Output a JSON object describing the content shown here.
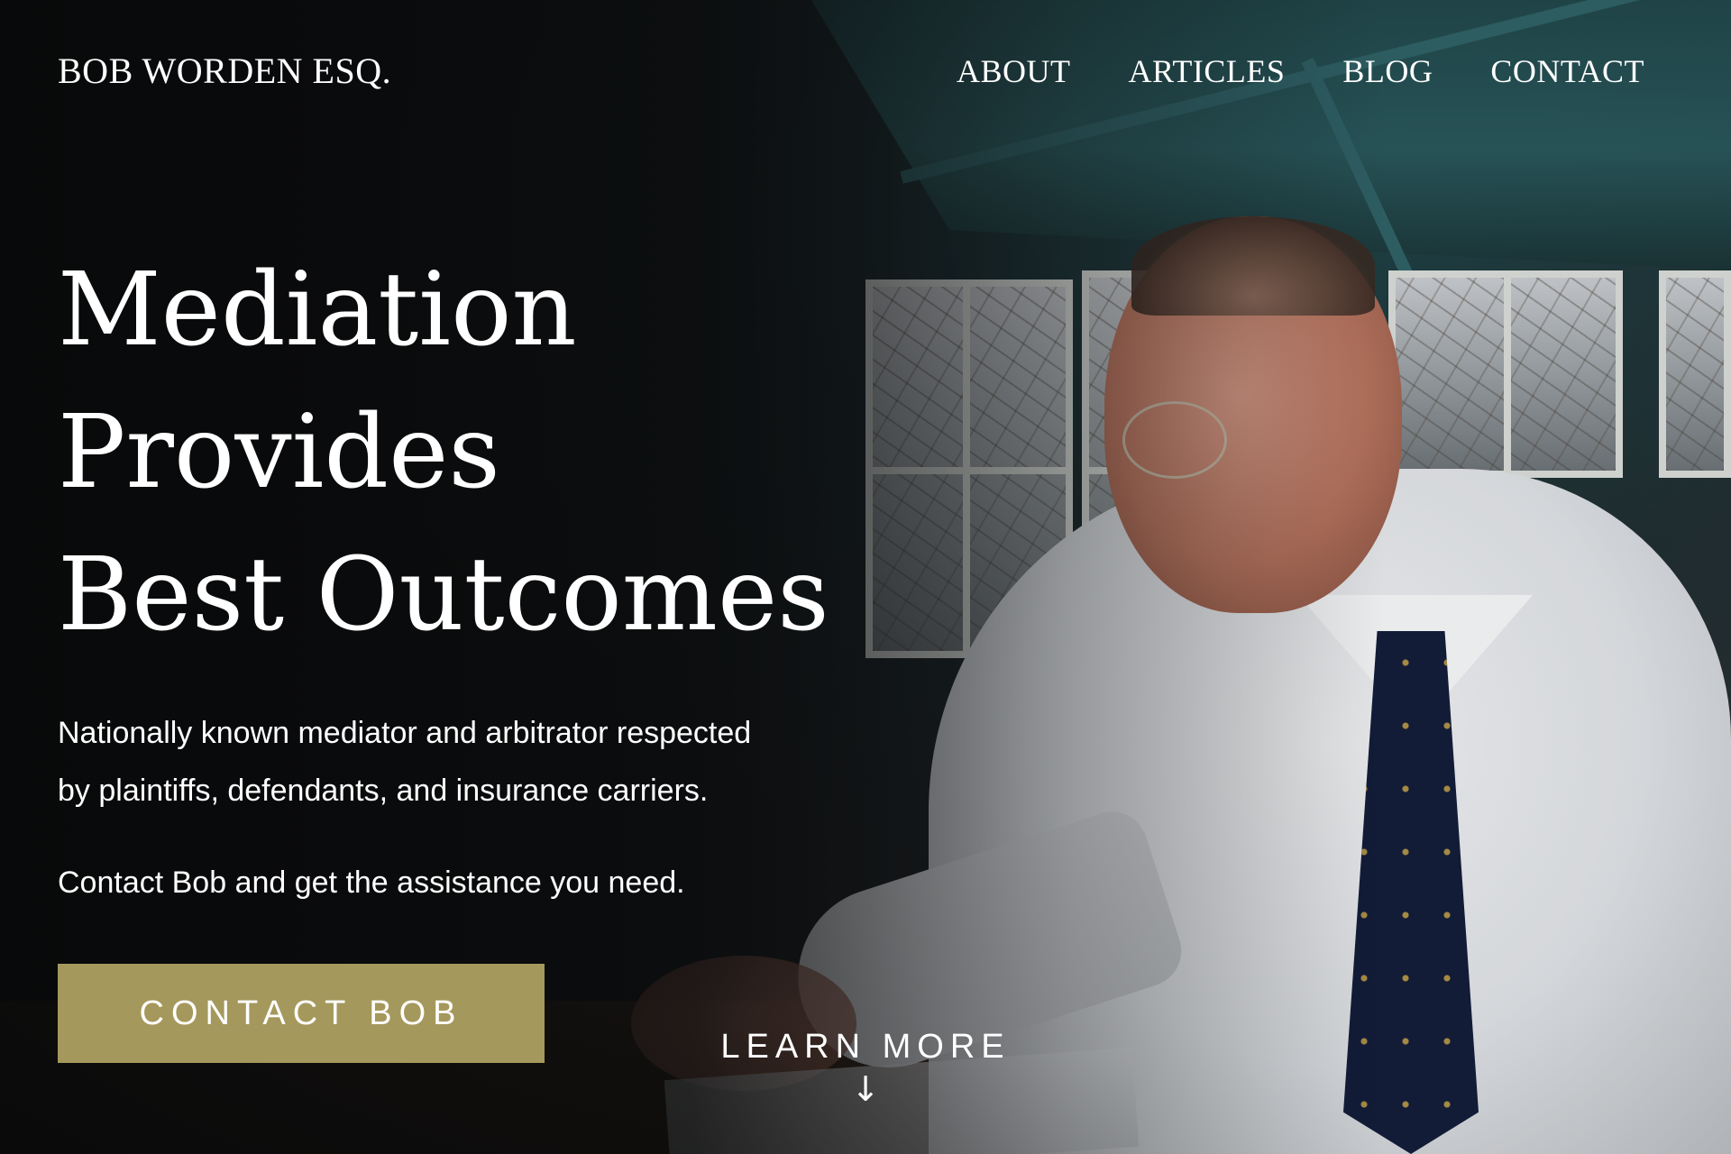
{
  "header": {
    "brand": "BOB WORDEN ESQ.",
    "nav": [
      "ABOUT",
      "ARTICLES",
      "BLOG",
      "CONTACT"
    ]
  },
  "hero": {
    "headline_line1": "Mediation Provides",
    "headline_line2": "Best Outcomes",
    "lead": "Nationally known mediator and arbitrator respected by plaintiffs, defendants, and insurance carriers.",
    "lead2": "Contact Bob and get the assistance you need.",
    "cta_label": "CONTACT BOB",
    "learn_more": "LEARN MORE",
    "learn_more_icon": "down-arrow-icon"
  },
  "colors": {
    "cta_background": "#a5985c",
    "text": "#ffffff",
    "overlay": "#0b0c0e"
  }
}
